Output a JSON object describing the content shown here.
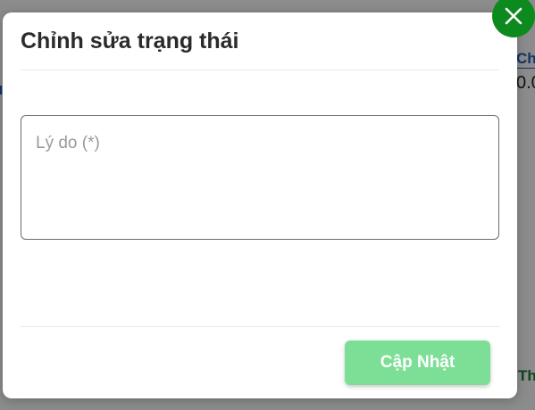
{
  "background": {
    "link_text": "Ch",
    "value_text": "0.0",
    "bottom_text": "Th"
  },
  "modal": {
    "title": "Chỉnh sửa trạng thái",
    "reason_placeholder": "Lý do (*)",
    "reason_value": "",
    "update_button_label": "Cập Nhật",
    "close_icon": "close-icon"
  },
  "colors": {
    "accent_green": "#0d8a1e",
    "button_disabled_green": "#7ddf96",
    "link_blue": "#1f5fbf"
  }
}
